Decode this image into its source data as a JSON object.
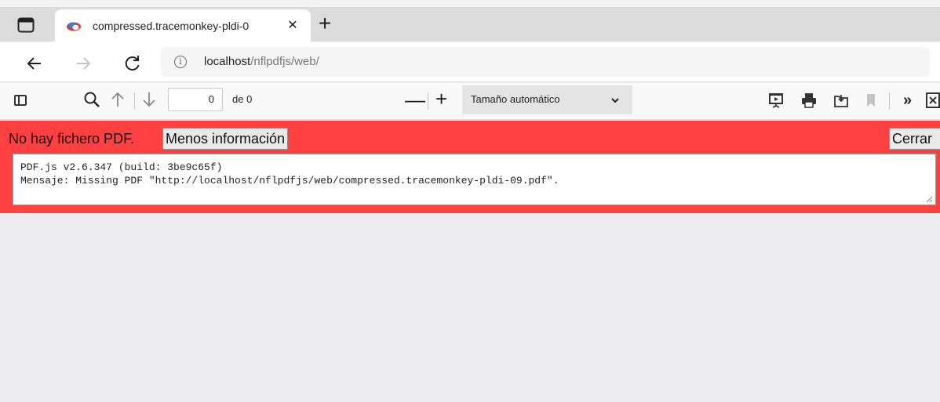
{
  "browser": {
    "tab": {
      "title": "compressed.tracemonkey-pldi-0",
      "close_glyph": "✕"
    },
    "new_tab_glyph": "+",
    "address": {
      "host": "localhost",
      "path": "/nflpdfjs/web/"
    }
  },
  "pdf_toolbar": {
    "page_number": "0",
    "page_count": "de 0",
    "scale_label": "Tamaño automático",
    "zoom_out_glyph": "—",
    "zoom_in_glyph": "+",
    "tools_glyph": "»"
  },
  "error_bar": {
    "message": "No hay fichero PDF.",
    "less_info_label": "Menos información",
    "close_label": "Cerrar",
    "details": "PDF.js v2.6.347 (build: 3be9c65f)\nMensaje: Missing PDF \"http://localhost/nflpdfjs/web/compressed.tracemonkey-pldi-09.pdf\"."
  },
  "colors": {
    "error_background": "#ff4040",
    "viewer_background": "#ededf0",
    "toolbar_background": "#f9f9fa"
  },
  "icons": [
    "tab-actions-icon",
    "cloud-favicon-icon",
    "close-icon",
    "plus-icon",
    "back-arrow-icon",
    "forward-arrow-icon",
    "refresh-icon",
    "info-icon",
    "sidebar-toggle-icon",
    "search-icon",
    "arrow-up-icon",
    "arrow-down-icon",
    "minus-icon",
    "chevron-down-icon",
    "presentation-mode-icon",
    "print-icon",
    "open-file-icon",
    "bookmark-icon",
    "double-chevron-right-icon"
  ]
}
